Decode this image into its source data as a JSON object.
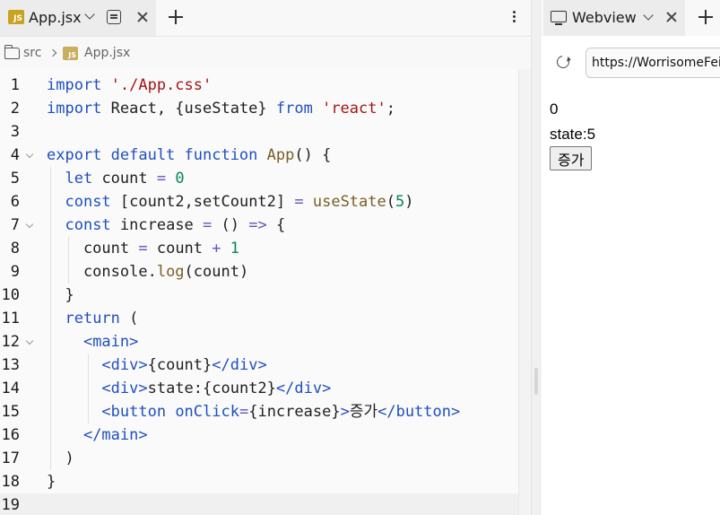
{
  "editor": {
    "tab": {
      "badge": "JS",
      "label": "App.jsx"
    },
    "breadcrumb": {
      "folder": "src",
      "badge": "JS",
      "file": "App.jsx"
    },
    "current_line": 19,
    "lines": [
      {
        "n": "1",
        "t": [
          [
            "k",
            "import "
          ],
          [
            "s",
            "'./App.css'"
          ]
        ]
      },
      {
        "n": "2",
        "t": [
          [
            "k",
            "import "
          ],
          [
            "p",
            "React, {useState} "
          ],
          [
            "k",
            "from "
          ],
          [
            "s",
            "'react'"
          ],
          [
            "p",
            ";"
          ]
        ]
      },
      {
        "n": "3",
        "t": []
      },
      {
        "n": "4",
        "fold": true,
        "t": [
          [
            "k",
            "export default function "
          ],
          [
            "f",
            "App"
          ],
          [
            "p",
            "() {"
          ]
        ]
      },
      {
        "n": "5",
        "t": [
          [
            "p",
            "  "
          ],
          [
            "k",
            "let "
          ],
          [
            "p",
            "count "
          ],
          [
            "o",
            "= "
          ],
          [
            "m",
            "0"
          ]
        ]
      },
      {
        "n": "6",
        "t": [
          [
            "p",
            "  "
          ],
          [
            "k",
            "const "
          ],
          [
            "p",
            "[count2,setCount2] "
          ],
          [
            "o",
            "= "
          ],
          [
            "f",
            "useState"
          ],
          [
            "p",
            "("
          ],
          [
            "m",
            "5"
          ],
          [
            "p",
            ")"
          ]
        ]
      },
      {
        "n": "7",
        "fold": true,
        "t": [
          [
            "p",
            "  "
          ],
          [
            "k",
            "const "
          ],
          [
            "p",
            "increase "
          ],
          [
            "o",
            "= "
          ],
          [
            "p",
            "() "
          ],
          [
            "o",
            "=> "
          ],
          [
            "p",
            "{"
          ]
        ]
      },
      {
        "n": "8",
        "t": [
          [
            "p",
            "    count "
          ],
          [
            "o",
            "= "
          ],
          [
            "p",
            "count "
          ],
          [
            "o",
            "+ "
          ],
          [
            "m",
            "1"
          ]
        ]
      },
      {
        "n": "9",
        "t": [
          [
            "p",
            "    console."
          ],
          [
            "f",
            "log"
          ],
          [
            "p",
            "(count)"
          ]
        ]
      },
      {
        "n": "10",
        "t": [
          [
            "p",
            "  }"
          ]
        ]
      },
      {
        "n": "11",
        "t": [
          [
            "p",
            "  "
          ],
          [
            "k",
            "return "
          ],
          [
            "p",
            "("
          ]
        ]
      },
      {
        "n": "12",
        "fold": true,
        "t": [
          [
            "p",
            "    "
          ],
          [
            "k",
            "<main>"
          ]
        ]
      },
      {
        "n": "13",
        "t": [
          [
            "p",
            "      "
          ],
          [
            "k",
            "<div>"
          ],
          [
            "p",
            "{count}"
          ],
          [
            "k",
            "</div>"
          ]
        ]
      },
      {
        "n": "14",
        "t": [
          [
            "p",
            "      "
          ],
          [
            "k",
            "<div>"
          ],
          [
            "p",
            "state:{count2}"
          ],
          [
            "k",
            "</div>"
          ]
        ]
      },
      {
        "n": "15",
        "t": [
          [
            "p",
            "      "
          ],
          [
            "k",
            "<button "
          ],
          [
            "a",
            "onClick"
          ],
          [
            "o",
            "="
          ],
          [
            "p",
            "{increase}"
          ],
          [
            "k",
            ">"
          ],
          [
            "p",
            "증가"
          ],
          [
            "k",
            "</button>"
          ]
        ]
      },
      {
        "n": "16",
        "t": [
          [
            "p",
            "    "
          ],
          [
            "k",
            "</main>"
          ]
        ]
      },
      {
        "n": "17",
        "t": [
          [
            "p",
            "  )"
          ]
        ]
      },
      {
        "n": "18",
        "t": [
          [
            "p",
            "}"
          ]
        ]
      },
      {
        "n": "19",
        "t": []
      }
    ]
  },
  "webview": {
    "tab_label": "Webview",
    "url": "https://WorrisomeFeisty",
    "output": {
      "count": "0",
      "state": "state:5",
      "button": "증가"
    }
  },
  "colors": {
    "keyword": "#1f4fbf",
    "string": "#a31515",
    "function": "#795e26",
    "number": "#098658",
    "operator": "#6a4fbf",
    "attribute": "#1f4fbf",
    "plain": "#1f1f1f"
  }
}
